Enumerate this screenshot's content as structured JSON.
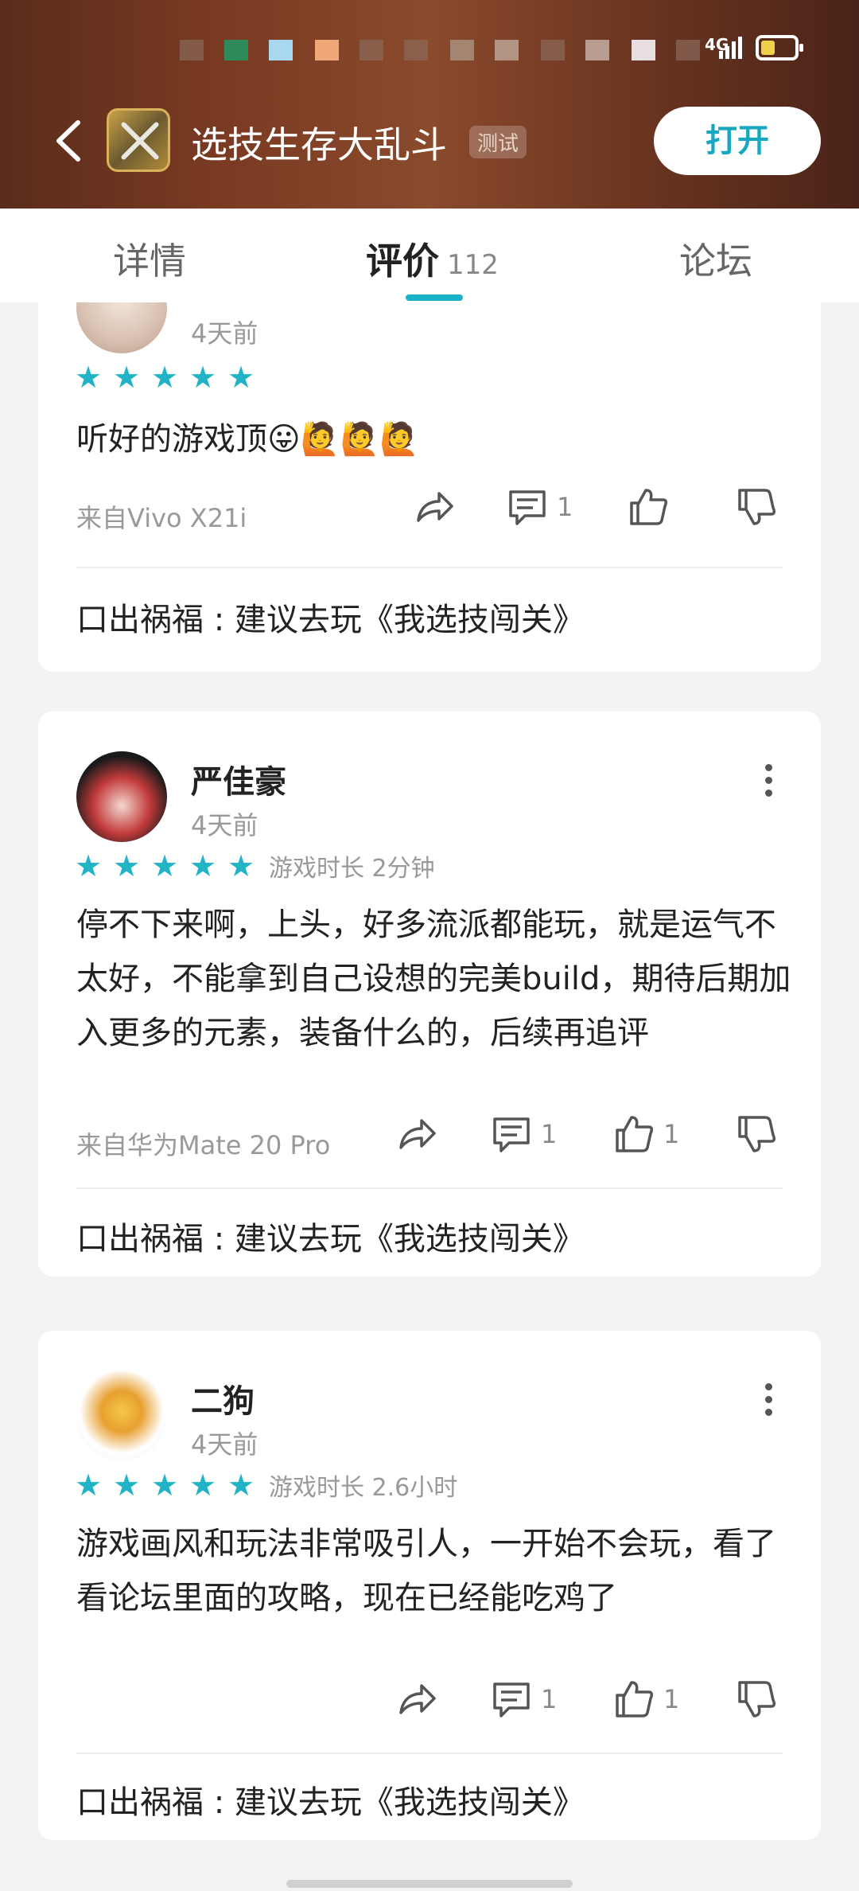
{
  "status_bar": {
    "network": "4G"
  },
  "header": {
    "app_name": "选技生存大乱斗",
    "tag": "测试",
    "open_label": "打开"
  },
  "tabs": [
    {
      "label": "详情"
    },
    {
      "label": "评价",
      "count": "112"
    },
    {
      "label": "论坛"
    }
  ],
  "reviews": [
    {
      "time": "4天前",
      "stars": 5,
      "content": "听好的游戏顶😛🙋🙋🙋",
      "device": "来自Vivo X21i",
      "comments": "1",
      "likes": "",
      "reply": "口出祸福 : 建议去玩《我选技闯关》"
    },
    {
      "author": "严佳豪",
      "time": "4天前",
      "stars": 5,
      "playtime": "游戏时长 2分钟",
      "content": "停不下来啊，上头，好多流派都能玩，就是运气不太好，不能拿到自己设想的完美build，期待后期加入更多的元素，装备什么的，后续再追评",
      "device": "来自华为Mate 20 Pro",
      "comments": "1",
      "likes": "1",
      "reply": "口出祸福 : 建议去玩《我选技闯关》"
    },
    {
      "author": "二狗",
      "time": "4天前",
      "stars": 5,
      "playtime": "游戏时长 2.6小时",
      "content": "游戏画风和玩法非常吸引人，一开始不会玩，看了看论坛里面的攻略，现在已经能吃鸡了",
      "comments": "1",
      "likes": "1",
      "reply": "口出祸福 : 建议去玩《我选技闯关》"
    }
  ],
  "colors": {
    "accent": "#19b3c9",
    "header_bg": "#6a3420"
  }
}
